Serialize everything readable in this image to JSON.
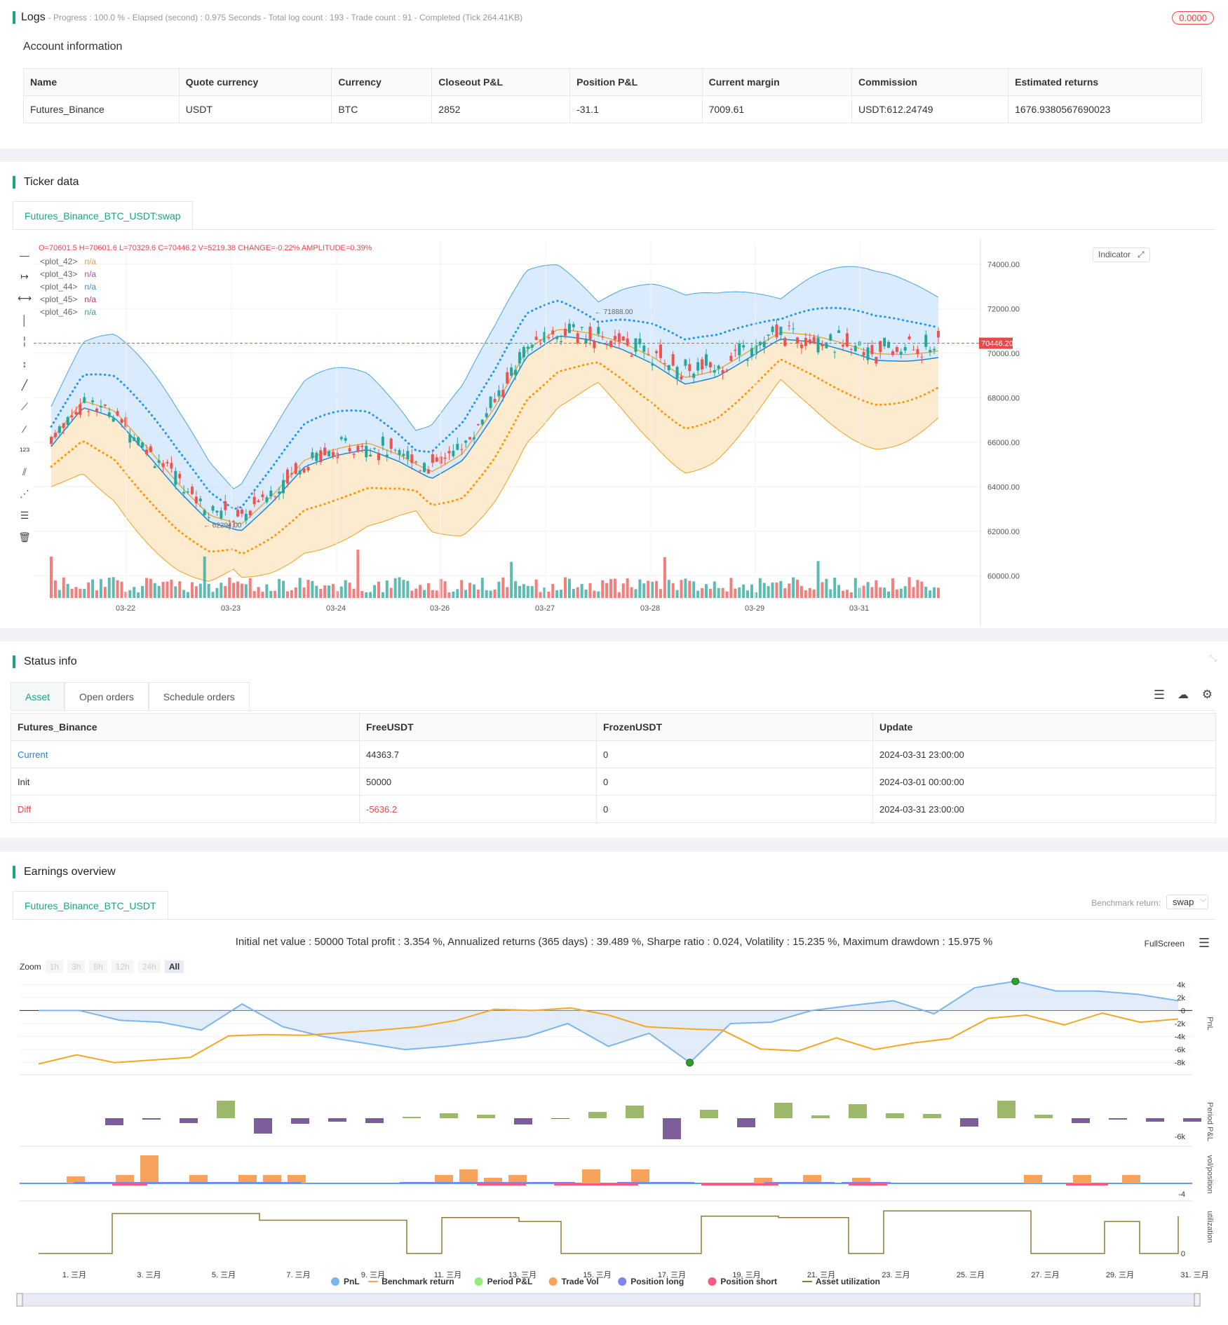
{
  "logs": {
    "title": "Logs",
    "meta": "- Progress : 100.0 % - Elapsed (second) : 0.975  Seconds - Total log count : 193 - Trade count : 91 - Completed (Tick 264.41KB)",
    "badge": "0.0000"
  },
  "account": {
    "title": "Account information",
    "headers": [
      "Name",
      "Quote currency",
      "Currency",
      "Closeout P&L",
      "Position P&L",
      "Current margin",
      "Commission",
      "Estimated returns"
    ],
    "row": [
      "Futures_Binance",
      "USDT",
      "BTC",
      "2852",
      "-31.1",
      "7009.61",
      "USDT:612.24749",
      "1676.9380567690023"
    ]
  },
  "ticker": {
    "title": "Ticker data",
    "tab": "Futures_Binance_BTC_USDT:swap",
    "ohlc": "O=70601.5 H=70601.6 L=70329.6 C=70446.2 V=5219.38 CHANGE=-0.22% AMPLITUDE=0.39%",
    "plots": [
      {
        "label": "<plot_42>",
        "value": "n/a",
        "color": "#f0a020"
      },
      {
        "label": "<plot_43>",
        "value": "n/a",
        "color": "#c040c0"
      },
      {
        "label": "<plot_44>",
        "value": "n/a",
        "color": "#2196f3"
      },
      {
        "label": "<plot_45>",
        "value": "n/a",
        "color": "#e91e63"
      },
      {
        "label": "<plot_46>",
        "value": "n/a",
        "color": "#26a69a"
      }
    ],
    "indicator_btn": "Indicator",
    "price_ticks": [
      "74000.00",
      "72000.00",
      "70000.00",
      "68000.00",
      "66000.00",
      "64000.00",
      "62000.00",
      "60000.00"
    ],
    "current_price": "70446.20",
    "high_label": "71888.00",
    "low_label": "62294.00",
    "date_ticks": [
      "03-22",
      "03-23",
      "03-24",
      "03-26",
      "03-27",
      "03-28",
      "03-29",
      "03-31"
    ],
    "chart_data": {
      "type": "candlestick",
      "ylim": [
        59000,
        75000
      ],
      "series_names": [
        "upper band",
        "basis",
        "lower band"
      ],
      "current_price": 70446.2,
      "high": 71888.0,
      "low": 62294.0
    }
  },
  "status": {
    "title": "Status info",
    "tabs": [
      "Asset",
      "Open orders",
      "Schedule orders"
    ],
    "headers": [
      "Futures_Binance",
      "FreeUSDT",
      "FrozenUSDT",
      "Update"
    ],
    "rows": [
      [
        "Current",
        "44363.7",
        "0",
        "2024-03-31 23:00:00"
      ],
      [
        "Init",
        "50000",
        "0",
        "2024-03-01 00:00:00"
      ],
      [
        "Diff",
        "-5636.2",
        "0",
        "2024-03-31 23:00:00"
      ]
    ]
  },
  "earnings": {
    "title": "Earnings overview",
    "tab": "Futures_Binance_BTC_USDT",
    "benchmark_label": "Benchmark return:",
    "benchmark_value": "swap",
    "summary": "Initial net value : 50000 Total profit : 3.354 %, Annualized returns (365 days) : 39.489 %, Sharpe ratio : 0.024, Volatility : 15.235 %, Maximum drawdown : 15.975 %",
    "fullscreen": "FullScreen",
    "zoom_label": "Zoom",
    "zoom_options": [
      "1h",
      "3h",
      "8h",
      "12h",
      "24h",
      "All"
    ],
    "pnl_ticks": [
      "4k",
      "2k",
      "0",
      "-2k",
      "-4k",
      "-6k",
      "-8k"
    ],
    "period_tick": "-6k",
    "vol_tick": "-4",
    "util_tick": "0",
    "axis_labels": [
      "PnL",
      "Period P&L",
      "vol/position",
      "utilization"
    ],
    "date_ticks": [
      "1. 三月",
      "3. 三月",
      "5. 三月",
      "7. 三月",
      "9. 三月",
      "11. 三月",
      "13. 三月",
      "15. 三月",
      "17. 三月",
      "19. 三月",
      "21. 三月",
      "23. 三月",
      "25. 三月",
      "27. 三月",
      "29. 三月",
      "31. 三月"
    ],
    "legend": [
      {
        "label": "PnL",
        "color": "#7cb5ec"
      },
      {
        "label": "Benchmark return",
        "color": "#f7a35c"
      },
      {
        "label": "Period P&L",
        "color": "#90ed7d"
      },
      {
        "label": "Trade Vol",
        "color": "#f7a35c"
      },
      {
        "label": "Position long",
        "color": "#8085e9"
      },
      {
        "label": "Position short",
        "color": "#f15c80"
      },
      {
        "label": "Asset utilization",
        "color": "#8d7a3a"
      }
    ],
    "chart_data": {
      "type": "line",
      "pnl": [
        0,
        0,
        -1500,
        -1800,
        -3000,
        1000,
        -2500,
        -4000,
        -5000,
        -6000,
        -5500,
        -4800,
        -4000,
        -2000,
        -5500,
        -3500,
        -8000,
        -2000,
        -1800,
        0,
        800,
        1500,
        -500,
        3500,
        4500,
        3000,
        3000,
        2500,
        1500
      ],
      "benchmark": [
        -8200,
        -6800,
        -8000,
        -7600,
        -7200,
        -3900,
        -3700,
        -3800,
        -3400,
        -3000,
        -2500,
        -1500,
        200,
        0,
        400,
        -700,
        -2500,
        -2800,
        -3000,
        -5900,
        -6200,
        -4200,
        -6000,
        -5000,
        -4300,
        -1200,
        -700,
        -2200,
        -400,
        -1800,
        -1300
      ]
    }
  }
}
